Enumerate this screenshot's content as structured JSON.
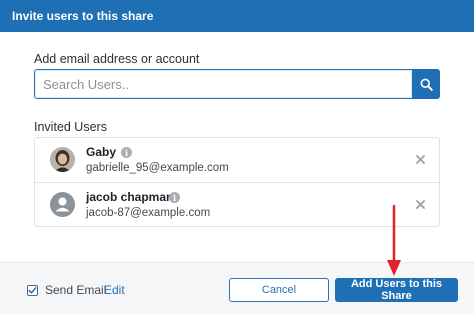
{
  "dialog": {
    "title": "Invite users to this share"
  },
  "search": {
    "label": "Add email address or account",
    "placeholder": "Search Users.."
  },
  "invited": {
    "label": "Invited Users",
    "users": [
      {
        "name": "Gaby",
        "email": "gabrielle_95@example.com",
        "avatar": "photo"
      },
      {
        "name": "jacob chapman",
        "email": "jacob-87@example.com",
        "avatar": "generic-person-icon"
      }
    ]
  },
  "footer": {
    "send_email_label": "Send Email",
    "send_email_checked": true,
    "edit_label": "Edit",
    "cancel_label": "Cancel",
    "add_label": "Add Users to this Share"
  },
  "colors": {
    "accent": "#1f6fb5",
    "annotation_arrow": "#e0232a"
  }
}
